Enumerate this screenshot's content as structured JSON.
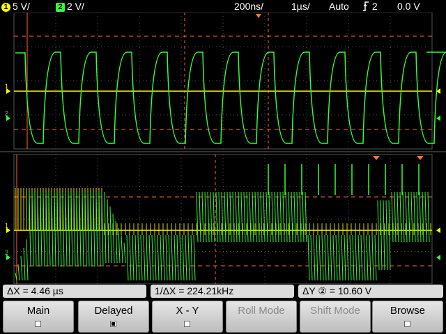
{
  "header": {
    "ch1_number": "1",
    "ch1_scale": "5 V/",
    "ch2_number": "2",
    "ch2_scale": "2 V/",
    "delay": "200ns/",
    "timebase": "1µs/",
    "trigger_mode": "Auto",
    "trigger_source": "2",
    "trigger_level": "0.0 V"
  },
  "colors": {
    "ch1": "#ffff00",
    "ch2": "#33ff33",
    "cursor": "#ff6633",
    "trigger_marker": "#ff7733",
    "grid": "#555555"
  },
  "measurements": {
    "delta_x": "ΔX =  4.46 µs",
    "inv_delta_x": "1/ΔX = 224.21kHz",
    "delta_y": "ΔY ② = 10.60  V"
  },
  "softkeys": {
    "main": "Main",
    "delayed": "Delayed",
    "xy": "X - Y",
    "roll": "Roll Mode",
    "shift": "Shift Mode",
    "browse": "Browse"
  },
  "icons": {
    "trigger": "rising-edge-icon",
    "ground_marker": "ground-icon",
    "checkbox": "checkbox-icon"
  }
}
